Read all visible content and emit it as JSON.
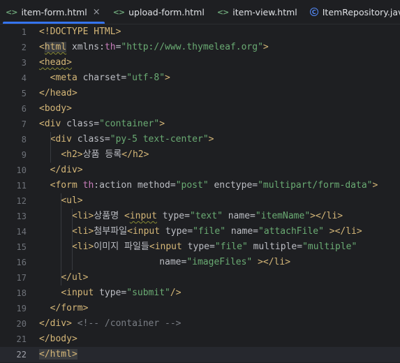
{
  "tabs": [
    {
      "label": "item-form.html",
      "type": "html",
      "active": true,
      "closable": true
    },
    {
      "label": "upload-form.html",
      "type": "html",
      "active": false,
      "closable": false
    },
    {
      "label": "item-view.html",
      "type": "html",
      "active": false,
      "closable": false
    },
    {
      "label": "ItemRepository.java",
      "type": "java",
      "active": false,
      "closable": false
    },
    {
      "label": "",
      "type": "java",
      "active": false,
      "closable": false
    }
  ],
  "colors": {
    "accent": "#3574f0",
    "background": "#1e1f22",
    "tag": "#d5b778",
    "string": "#6aab73",
    "namespace": "#c77dbb",
    "comment": "#7a7e85"
  },
  "editor": {
    "current_line": 22,
    "lines": [
      {
        "n": "1",
        "t": [
          {
            "c": "tag",
            "s": "<!DOCTYPE HTML>"
          }
        ]
      },
      {
        "n": "2",
        "t": [
          {
            "c": "tag",
            "s": "<"
          },
          {
            "c": "tag",
            "s": "html",
            "x": "hl-tag squig"
          },
          {
            "c": "attr",
            "s": " xmlns:"
          },
          {
            "c": "th",
            "s": "th"
          },
          {
            "c": "attr",
            "s": "="
          },
          {
            "c": "str",
            "s": "\"http://www.thymeleaf.org\""
          },
          {
            "c": "tag",
            "s": ">"
          }
        ]
      },
      {
        "n": "3",
        "t": [
          {
            "c": "tag",
            "s": "<head>",
            "x": "squig"
          }
        ]
      },
      {
        "n": "4",
        "t": [
          {
            "c": "txt",
            "s": "  "
          },
          {
            "c": "tag",
            "s": "<meta"
          },
          {
            "c": "attr",
            "s": " charset="
          },
          {
            "c": "str",
            "s": "\"utf-8\""
          },
          {
            "c": "tag",
            "s": ">"
          }
        ]
      },
      {
        "n": "5",
        "t": [
          {
            "c": "tag",
            "s": "</head>"
          }
        ]
      },
      {
        "n": "6",
        "t": [
          {
            "c": "tag",
            "s": "<body>"
          }
        ]
      },
      {
        "n": "7",
        "t": [
          {
            "c": "tag",
            "s": "<div"
          },
          {
            "c": "attr",
            "s": " class="
          },
          {
            "c": "str",
            "s": "\"container\""
          },
          {
            "c": "tag",
            "s": ">"
          }
        ]
      },
      {
        "n": "8",
        "t": [
          {
            "c": "txt",
            "s": "  "
          },
          {
            "c": "tag",
            "s": "<div"
          },
          {
            "c": "attr",
            "s": " class="
          },
          {
            "c": "str",
            "s": "\"py-5 text-center\""
          },
          {
            "c": "tag",
            "s": ">"
          }
        ]
      },
      {
        "n": "9",
        "t": [
          {
            "c": "txt",
            "s": "    "
          },
          {
            "c": "tag",
            "s": "<h2>"
          },
          {
            "c": "kor",
            "s": "상품 등록"
          },
          {
            "c": "tag",
            "s": "</h2>"
          }
        ]
      },
      {
        "n": "10",
        "t": [
          {
            "c": "txt",
            "s": "  "
          },
          {
            "c": "tag",
            "s": "</div>"
          }
        ]
      },
      {
        "n": "11",
        "t": [
          {
            "c": "txt",
            "s": "  "
          },
          {
            "c": "tag",
            "s": "<form"
          },
          {
            "c": "attr",
            "s": " "
          },
          {
            "c": "th",
            "s": "th"
          },
          {
            "c": "attr",
            "s": ":action method="
          },
          {
            "c": "str",
            "s": "\"post\""
          },
          {
            "c": "attr",
            "s": " enctype="
          },
          {
            "c": "str",
            "s": "\"multipart/form-data\""
          },
          {
            "c": "tag",
            "s": ">"
          }
        ]
      },
      {
        "n": "12",
        "t": [
          {
            "c": "txt",
            "s": "    "
          },
          {
            "c": "tag",
            "s": "<ul>"
          }
        ]
      },
      {
        "n": "13",
        "t": [
          {
            "c": "txt",
            "s": "      "
          },
          {
            "c": "tag",
            "s": "<li>"
          },
          {
            "c": "kor",
            "s": "상품명 "
          },
          {
            "c": "tag",
            "s": "<"
          },
          {
            "c": "tag",
            "s": "input",
            "x": "squig"
          },
          {
            "c": "attr",
            "s": " type="
          },
          {
            "c": "str",
            "s": "\"text\""
          },
          {
            "c": "attr",
            "s": " name="
          },
          {
            "c": "str",
            "s": "\"itemName\""
          },
          {
            "c": "tag",
            "s": "></li>"
          }
        ]
      },
      {
        "n": "14",
        "t": [
          {
            "c": "txt",
            "s": "      "
          },
          {
            "c": "tag",
            "s": "<li>"
          },
          {
            "c": "kor",
            "s": "첨부파일"
          },
          {
            "c": "tag",
            "s": "<input"
          },
          {
            "c": "attr",
            "s": " type="
          },
          {
            "c": "str",
            "s": "\"file\""
          },
          {
            "c": "attr",
            "s": " name="
          },
          {
            "c": "str",
            "s": "\"attachFile\""
          },
          {
            "c": "attr",
            "s": " "
          },
          {
            "c": "tag",
            "s": "></li>"
          }
        ]
      },
      {
        "n": "15",
        "t": [
          {
            "c": "txt",
            "s": "      "
          },
          {
            "c": "tag",
            "s": "<li>"
          },
          {
            "c": "kor",
            "s": "이미지 파일들"
          },
          {
            "c": "tag",
            "s": "<input"
          },
          {
            "c": "attr",
            "s": " type="
          },
          {
            "c": "str",
            "s": "\"file\""
          },
          {
            "c": "attr",
            "s": " multiple="
          },
          {
            "c": "str",
            "s": "\"multiple\""
          }
        ]
      },
      {
        "n": "16",
        "t": [
          {
            "c": "txt",
            "s": "                      "
          },
          {
            "c": "attr",
            "s": "name="
          },
          {
            "c": "str",
            "s": "\"imageFiles\""
          },
          {
            "c": "attr",
            "s": " "
          },
          {
            "c": "tag",
            "s": "></li>"
          }
        ]
      },
      {
        "n": "17",
        "t": [
          {
            "c": "txt",
            "s": "    "
          },
          {
            "c": "tag",
            "s": "</ul>"
          }
        ]
      },
      {
        "n": "18",
        "t": [
          {
            "c": "txt",
            "s": "    "
          },
          {
            "c": "tag",
            "s": "<input"
          },
          {
            "c": "attr",
            "s": " type="
          },
          {
            "c": "str",
            "s": "\"submit\""
          },
          {
            "c": "tag",
            "s": "/>"
          }
        ]
      },
      {
        "n": "19",
        "t": [
          {
            "c": "txt",
            "s": "  "
          },
          {
            "c": "tag",
            "s": "</form>"
          }
        ]
      },
      {
        "n": "20",
        "t": [
          {
            "c": "tag",
            "s": "</div>"
          },
          {
            "c": "txt",
            "s": " "
          },
          {
            "c": "cmt",
            "s": "<!-- /container -->"
          }
        ]
      },
      {
        "n": "21",
        "t": [
          {
            "c": "tag",
            "s": "</body>"
          }
        ]
      },
      {
        "n": "22",
        "t": [
          {
            "c": "tag",
            "s": "</html>",
            "x": "hl-tag"
          }
        ]
      }
    ]
  }
}
